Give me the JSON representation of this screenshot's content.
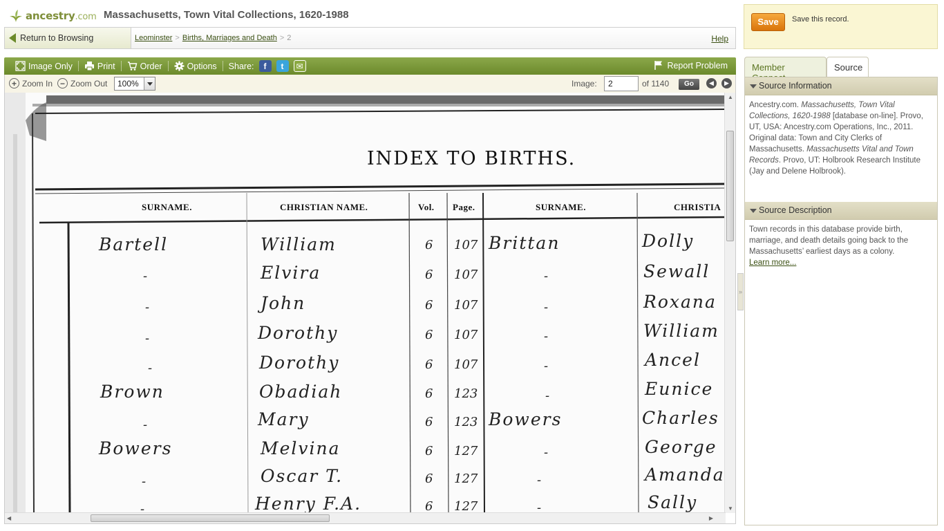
{
  "header": {
    "logo": {
      "brand": "ancestry",
      "suffix": ".com"
    },
    "title": "Massachusetts, Town Vital Collections, 1620-1988"
  },
  "browse": {
    "return_label": "Return to Browsing",
    "breadcrumbs": [
      "Leominster",
      "Births, Marriages and Death",
      "2"
    ],
    "help": "Help"
  },
  "toolbar": {
    "image_only": "Image Only",
    "print": "Print",
    "order": "Order",
    "options": "Options",
    "share": "Share:",
    "share_icons": [
      "facebook-icon",
      "twitter-icon",
      "email-icon"
    ],
    "report": "Report Problem"
  },
  "zoom": {
    "zoom_in": "Zoom In",
    "zoom_out": "Zoom Out",
    "level": "100%",
    "image_label": "Image:",
    "image_value": "2",
    "of_label": "of 1140",
    "go": "Go"
  },
  "document": {
    "heading": "INDEX TO BIRTHS.",
    "columns": [
      "SURNAME.",
      "CHRISTIAN NAME.",
      "Vol.",
      "Page.",
      "SURNAME.",
      "CHRISTIA"
    ],
    "rows": [
      {
        "surname": "Bartell",
        "christian": "William",
        "vol": "6",
        "page": "107",
        "surname2": "Brittan",
        "christian2": "Dolly"
      },
      {
        "surname": "-",
        "christian": "Elvira",
        "vol": "6",
        "page": "107",
        "surname2": "-",
        "christian2": "Sewall"
      },
      {
        "surname": "-",
        "christian": "John",
        "vol": "6",
        "page": "107",
        "surname2": "-",
        "christian2": "Roxana"
      },
      {
        "surname": "-",
        "christian": "Dorothy",
        "vol": "6",
        "page": "107",
        "surname2": "-",
        "christian2": "William"
      },
      {
        "surname": "-",
        "christian": "Dorothy",
        "vol": "6",
        "page": "107",
        "surname2": "-",
        "christian2": "Ancel"
      },
      {
        "surname": "Brown",
        "christian": "Obadiah",
        "vol": "6",
        "page": "123",
        "surname2": "-",
        "christian2": "Eunice"
      },
      {
        "surname": "-",
        "christian": "Mary",
        "vol": "6",
        "page": "123",
        "surname2": "Bowers",
        "christian2": "Charles"
      },
      {
        "surname": "Bowers",
        "christian": "Melvina",
        "vol": "6",
        "page": "127",
        "surname2": "-",
        "christian2": "George"
      },
      {
        "surname": "-",
        "christian": "Oscar T.",
        "vol": "6",
        "page": "127",
        "surname2": "-",
        "christian2": "Amanda"
      },
      {
        "surname": "-",
        "christian": "Henry F.A.",
        "vol": "6",
        "page": "127",
        "surname2": "-",
        "christian2": "Sally"
      }
    ]
  },
  "sidebar": {
    "save_button": "Save",
    "save_text": "Save this record.",
    "tabs": [
      "Member Connect",
      "Source"
    ],
    "active_tab": "Source",
    "source_info_title": "Source Information",
    "source_info": {
      "p1": "Ancestry.com.",
      "p1_italic": "Massachusetts, Town Vital Collections, 1620-1988",
      "p1_rest": "[database on-line]. Provo, UT, USA: Ancestry.com Operations, Inc., 2011.",
      "p2": "Original data: Town and City Clerks of Massachusetts.",
      "p2_italic": "Massachusetts Vital and Town Records",
      "p2_rest": ". Provo, UT: Holbrook Research Institute (Jay and Delene Holbrook)."
    },
    "source_desc_title": "Source Description",
    "source_desc": "Town records in this database provide birth, marriage, and death details going back to the Massachusetts’ earliest days as a colony.",
    "learn_more": "Learn more..."
  },
  "colors": {
    "accent_green": "#6c8a2c",
    "save_orange": "#e8880f",
    "panel_header": "#d8d3b8"
  }
}
